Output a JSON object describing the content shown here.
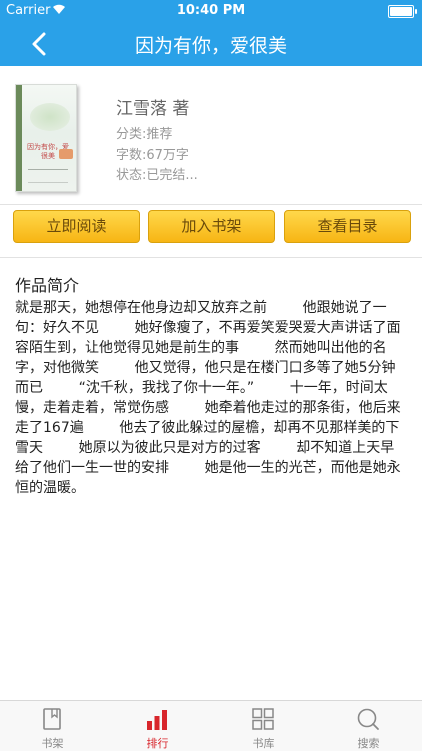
{
  "status_bar": {
    "carrier": "Carrier",
    "time": "10:40 PM"
  },
  "nav": {
    "title": "因为有你，爱很美",
    "back_icon": "chevron-left-icon"
  },
  "book": {
    "cover_title": "因为有你，爱很美",
    "author": "江雪落  著",
    "category": "分类:推荐",
    "word_count": "字数:67万字",
    "status": "状态:已完结..."
  },
  "actions": {
    "read_label": "立即阅读",
    "shelf_label": "加入书架",
    "catalog_label": "查看目录"
  },
  "intro": {
    "heading": "作品简介",
    "text": "就是那天，她想停在他身边却又放弃之前        他跟她说了一句：好久不见        她好像瘦了，不再爱笑爱哭爱大声讲话了面容陌生到，让他觉得见她是前生的事        然而她叫出他的名字，对他微笑        他又觉得，他只是在楼门口多等了她5分钟而已        “沈千秋，我找了你十一年。”        十一年，时间太慢，走着走着，常觉伤感        她牵着他走过的那条街，他后来走了167遍        他去了彼此躲过的屋檐，却再不见那样美的下雪天        她原以为彼此只是对方的过客        却不知道上天早给了他们一生一世的安排        她是他一生的光芒，而他是她永恒的温暖。"
  },
  "tabs": [
    {
      "label": "书架",
      "icon": "bookshelf-icon",
      "active": false
    },
    {
      "label": "排行",
      "icon": "ranking-bar-icon",
      "active": true
    },
    {
      "label": "书库",
      "icon": "library-grid-icon",
      "active": false
    },
    {
      "label": "搜索",
      "icon": "search-icon",
      "active": false
    }
  ],
  "colors": {
    "nav_background": "#2aa1e8",
    "button_gold": "#f7b514",
    "active_tab": "#d8262c"
  }
}
